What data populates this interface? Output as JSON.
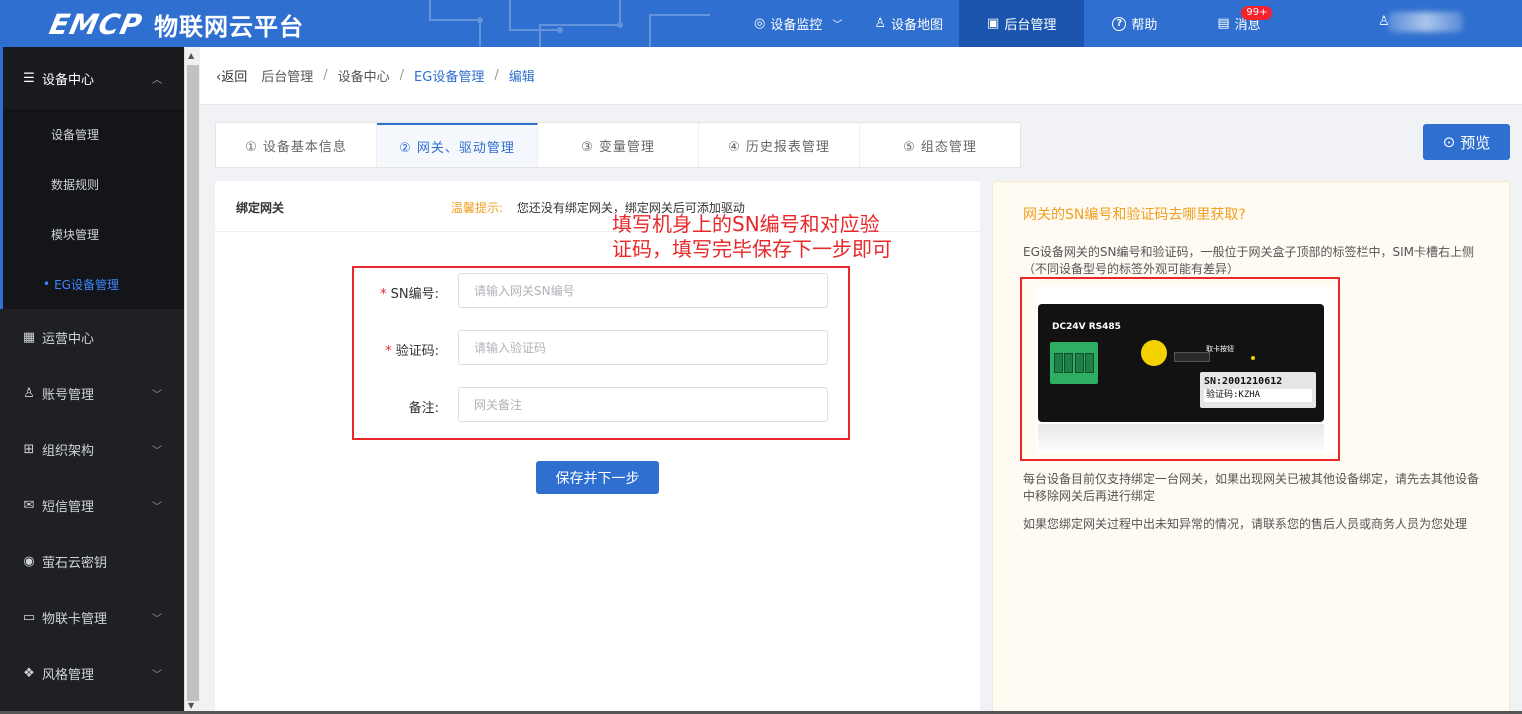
{
  "colors": {
    "primary": "#2f6fcf",
    "sidebar": "#1f2024",
    "annotation": "#e8282b",
    "tip": "#f0a020"
  },
  "header": {
    "logo_mark": "EMCP",
    "logo_name": "物联网云平台",
    "nav": [
      {
        "label": "设备监控",
        "icon": "location-icon",
        "glyph": "◎",
        "has_dropdown": true
      },
      {
        "label": "设备地图",
        "icon": "user-icon",
        "glyph": "♙",
        "has_dropdown": false
      },
      {
        "label": "后台管理",
        "icon": "monitor-icon",
        "glyph": "▣",
        "has_dropdown": false,
        "active": true
      },
      {
        "label": "帮助",
        "icon": "question-icon",
        "glyph": "?",
        "has_dropdown": false
      },
      {
        "label": "消息",
        "icon": "message-icon",
        "glyph": "▤",
        "badge": "99+"
      }
    ],
    "user_icon": "user-icon"
  },
  "sidebar": {
    "groups": [
      {
        "label": "设备中心",
        "icon": "device-icon",
        "glyph": "☰",
        "open": true,
        "items": [
          {
            "label": "设备管理"
          },
          {
            "label": "数据规则"
          },
          {
            "label": "模块管理"
          },
          {
            "label": "EG设备管理",
            "active": true
          }
        ]
      },
      {
        "label": "运营中心",
        "icon": "chart-icon",
        "glyph": "▦"
      },
      {
        "label": "账号管理",
        "icon": "user-icon",
        "glyph": "♙",
        "arrow": true
      },
      {
        "label": "组织架构",
        "icon": "org-icon",
        "glyph": "⊞",
        "arrow": true
      },
      {
        "label": "短信管理",
        "icon": "sms-icon",
        "glyph": "✉",
        "arrow": true
      },
      {
        "label": "萤石云密钥",
        "icon": "key-icon",
        "glyph": "◉"
      },
      {
        "label": "物联卡管理",
        "icon": "card-icon",
        "glyph": "▭",
        "arrow": true
      },
      {
        "label": "风格管理",
        "icon": "style-icon",
        "glyph": "❖",
        "arrow": true
      }
    ]
  },
  "breadcrumb": {
    "back": "返回",
    "items": [
      "后台管理",
      "设备中心",
      "EG设备管理",
      "编辑"
    ]
  },
  "tabs": [
    {
      "label": "① 设备基本信息"
    },
    {
      "label": "② 网关、驱动管理",
      "active": true
    },
    {
      "label": "③ 变量管理"
    },
    {
      "label": "④ 历史报表管理"
    },
    {
      "label": "⑤ 组态管理"
    }
  ],
  "preview_button": "预览",
  "form": {
    "title": "绑定网关",
    "tip_label": "温馨提示:",
    "tip_text": "您还没有绑定网关，绑定网关后可添加驱动",
    "annotation_line1": "填写机身上的SN编号和对应验",
    "annotation_line2": "证码，填写完毕保存下一步即可",
    "fields": [
      {
        "label": "SN编号:",
        "required": true,
        "placeholder": "请输入网关SN编号",
        "value": ""
      },
      {
        "label": "验证码:",
        "required": true,
        "placeholder": "请输入验证码",
        "value": ""
      },
      {
        "label": "备注:",
        "required": false,
        "placeholder": "网关备注",
        "value": ""
      }
    ],
    "required_mark": "*",
    "save_button": "保存并下一步"
  },
  "help": {
    "title": "网关的SN编号和验证码去哪里获取?",
    "p1": "EG设备网关的SN编号和验证码，一般位于网关盒子顶部的标签栏中，SIM卡槽右上侧（不同设备型号的标签外观可能有差异）",
    "device": {
      "label_top": "DC24V RS485",
      "slot_label": "取卡按钮",
      "sn": "SN:2001210612",
      "code": "验证码:KZHA"
    },
    "p2": "每台设备目前仅支持绑定一台网关，如果出现网关已被其他设备绑定，请先去其他设备中移除网关后再进行绑定",
    "p3": "如果您绑定网关过程中出未知异常的情况，请联系您的售后人员或商务人员为您处理"
  }
}
